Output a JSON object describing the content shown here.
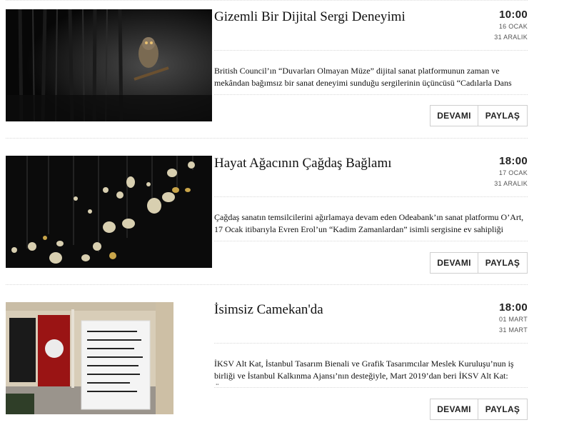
{
  "events": [
    {
      "title": "Gizemli Bir Dijital Sergi Deneyimi",
      "time": "10:00",
      "start_date": "16 OCAK",
      "end_date": "31 ARALIK",
      "description": "British Council’ın “Duvarları Olmayan Müze” dijital sanat platformunun zaman ve mekândan bağımsız bir sanat deneyimi sunduğu sergilerinin üçüncüsü “Cadılarla Dans Etmek” ziyaretçilerle buluşuyor. Kürasyonlu dijital sergi izleyicileri gizemli bir yolculuğa davet ediyor.",
      "more_label": "DEVAMI",
      "share_label": "PAYLAŞ"
    },
    {
      "title": "Hayat Ağacının Çağdaş Bağlamı",
      "time": "18:00",
      "start_date": "17 OCAK",
      "end_date": "31 ARALIK",
      "description": "Çağdaş sanatın temsilcilerini ağırlamaya devam eden Odeabank’ın sanat platformu O’Art, 17 Ocak itibarıyla Evren Erol’un “Kadim Zamanlardan” isimli sergisine ev sahipliği yapıyor. Evren Erol bu sergisinde Hayat Ağacı imgesini çağdaş bir bağlamda yeniden yorumluyor.",
      "more_label": "DEVAMI",
      "share_label": "PAYLAŞ"
    },
    {
      "title": "İsimsiz Camekan'da",
      "time": "18:00",
      "start_date": "01 MART",
      "end_date": "31 MART",
      "description": "İKSV Alt Kat, İstanbul Tasarım Bienali ve Grafik Tasarımcılar Meslek Kuruluşu’nun iş birliği ve İstanbul Kalkınma Ajansı’nın desteğiyle, Mart 2019’dan beri İKSV Alt Kat: Öğrenme ve Etkileşim Alanı’nın vitrinlerinde yer alan Camekân projesiyle tasarımcılara yer veriyor.",
      "more_label": "DEVAMI",
      "share_label": "PAYLAŞ"
    }
  ]
}
